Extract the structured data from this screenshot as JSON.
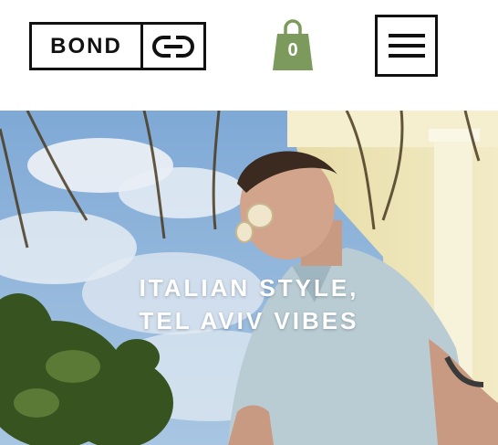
{
  "header": {
    "logo": {
      "text": "BOND",
      "icon": "link-icon"
    },
    "cart": {
      "count": "0",
      "icon": "shopping-bag-icon",
      "color": "#7b9a5c"
    },
    "menu": {
      "icon": "hamburger-icon"
    }
  },
  "hero": {
    "title_line1": "ITALIAN STYLE,",
    "title_line2": "TEL AVIV VIBES"
  },
  "colors": {
    "sky": "#8fb6dd",
    "cloud": "#e9eef3",
    "building": "#efe5b4",
    "shirt": "#b9ccd4",
    "foliage": "#3c5b25"
  }
}
